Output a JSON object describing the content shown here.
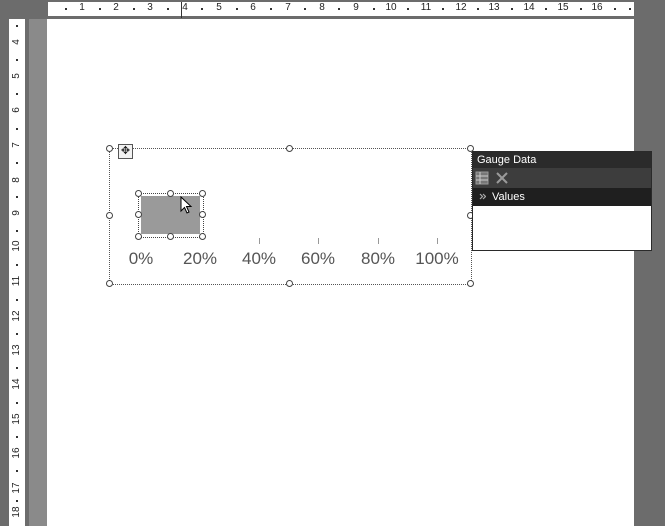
{
  "ruler": {
    "horizontal_labels": [
      "1",
      "2",
      "3",
      "4",
      "5",
      "6",
      "7",
      "8",
      "9",
      "10",
      "11",
      "12",
      "13",
      "14",
      "15",
      "16"
    ],
    "vertical_labels": [
      "4",
      "5",
      "6",
      "7",
      "8",
      "9",
      "10",
      "11",
      "12",
      "13",
      "14",
      "15",
      "16",
      "17",
      "18"
    ]
  },
  "gauge": {
    "scale_labels": [
      "0%",
      "20%",
      "40%",
      "60%",
      "80%",
      "100%"
    ]
  },
  "gauge_panel": {
    "title": "Gauge Data",
    "values_label": "Values",
    "toolbar_icons": [
      "table-icon",
      "delete-icon"
    ]
  },
  "colors": {
    "panel_header": "#2b2b2b",
    "bar_fill": "#9a9a9a",
    "scale_text": "#555555"
  }
}
